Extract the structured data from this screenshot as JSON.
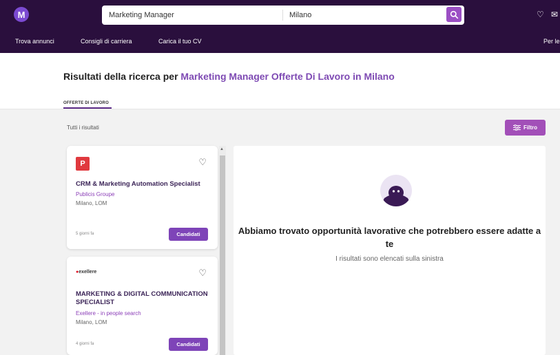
{
  "header": {
    "logo_letter": "M",
    "search": {
      "query": "Marketing Manager",
      "location": "Milano"
    },
    "nav": [
      "Trova annunci",
      "Consigli di carriera",
      "Carica il tuo CV",
      "Per le"
    ]
  },
  "results": {
    "title_prefix": "Risultati della ricerca per ",
    "title_highlight": "Marketing Manager Offerte Di Lavoro in Milano",
    "tab": "OFFERTE DI LAVORO",
    "all_results": "Tutti i risultati",
    "filter_label": "Filtro"
  },
  "jobs": [
    {
      "logo_text": "P",
      "title": "CRM & Marketing Automation Specialist",
      "company": "Publicis Groupe",
      "location": "Milano, LOM",
      "age": "5 giorni fa",
      "apply": "Candidati"
    },
    {
      "logo_text": "exellere",
      "title": "MARKETING & DIGITAL COMMUNICATION SPECIALIST",
      "company": "Exellere - in people search",
      "location": "Milano, LOM",
      "age": "4 giorni fa",
      "apply": "Candidati"
    }
  ],
  "detail": {
    "title": "Abbiamo trovato opportunità lavorative che potrebbero essere adatte a te",
    "subtitle": "I risultati sono elencati sulla sinistra"
  },
  "colors": {
    "header_bg": "#2a0f3d",
    "accent": "#7e44b8",
    "filter_btn": "#a24fb8",
    "logo_red": "#e0393e"
  }
}
